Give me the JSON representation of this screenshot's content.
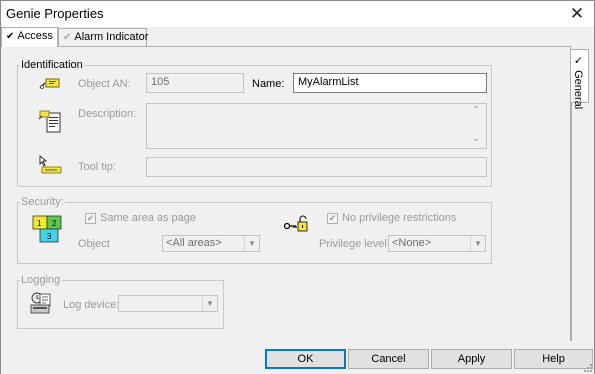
{
  "window": {
    "title": "Genie Properties",
    "close_glyph": "✕"
  },
  "tabs": [
    {
      "label": "Access",
      "checked": true,
      "active": true
    },
    {
      "label": "Alarm Indicator",
      "checked": true,
      "active": false
    }
  ],
  "side_tab": {
    "label": "General",
    "check": "✓"
  },
  "identification": {
    "legend": "Identification",
    "object_an_label": "Object AN:",
    "object_an_value": "105",
    "name_label": "Name:",
    "name_value": "MyAlarmList",
    "description_label": "Description:",
    "description_value": "",
    "tooltip_label": "Tool tip:",
    "tooltip_value": "",
    "scroll_up": "⌃",
    "scroll_down": "⌄"
  },
  "security": {
    "legend": "Security:",
    "same_area_label": "Same area as page",
    "same_area_checked": true,
    "object_label": "Object",
    "object_value": "<All areas>",
    "no_privilege_label": "No privilege restrictions",
    "no_privilege_checked": true,
    "privilege_label": "Privilege level:",
    "privilege_value": "<None>"
  },
  "logging": {
    "legend": "Logging",
    "log_device_label": "Log device:",
    "log_device_value": ""
  },
  "buttons": {
    "ok": "OK",
    "cancel": "Cancel",
    "apply": "Apply",
    "help": "Help"
  },
  "icon_names": {
    "object_an": "tag-key-icon",
    "description": "document-icon",
    "tooltip": "tooltip-icon",
    "security": "area-puzzle-icon",
    "privilege": "key-lock-icon",
    "logging": "log-device-icon"
  },
  "colors": {
    "default_button_border": "#0078d7",
    "disabled_text": "#9a9a9a",
    "area_green": "#58c94a",
    "area_yellow": "#f5e830",
    "area_cyan": "#3fd3e8"
  }
}
